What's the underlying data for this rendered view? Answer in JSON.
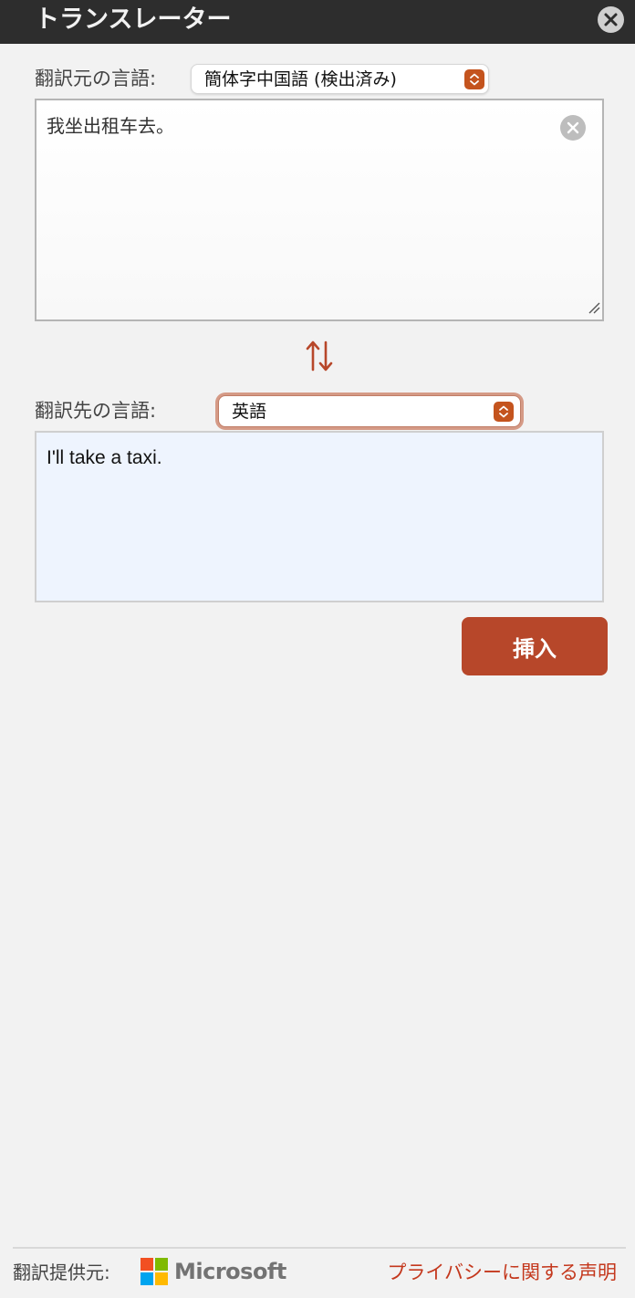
{
  "window": {
    "title": "トランスレーター",
    "close_icon": "close-icon"
  },
  "source": {
    "label": "翻訳元の言語:",
    "language": "簡体字中国語 (検出済み)",
    "text": "我坐出租车去。"
  },
  "target": {
    "label": "翻訳先の言語:",
    "language": "英語",
    "text": "I'll take a taxi."
  },
  "actions": {
    "insert_label": "挿入"
  },
  "footer": {
    "provider_label": "翻訳提供元:",
    "provider_name": "Microsoft",
    "privacy_link": "プライバシーに関する声明"
  },
  "colors": {
    "accent": "#b7472a",
    "titlebar": "#2d2d2d",
    "target_bg": "#eef4fe",
    "ms_red": "#f25022",
    "ms_green": "#7fba00",
    "ms_blue": "#00a4ef",
    "ms_yellow": "#ffb900"
  }
}
